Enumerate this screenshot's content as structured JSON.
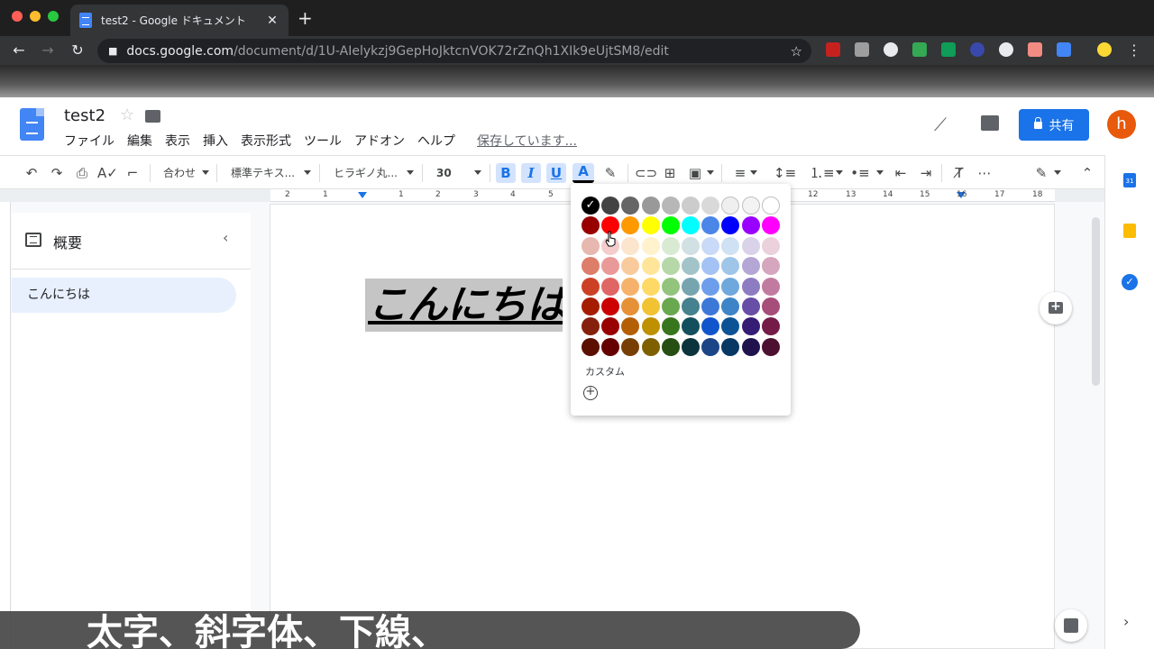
{
  "browser": {
    "tab_title": "test2 - Google ドキュメント",
    "tab_close": "✕",
    "new_tab": "+",
    "url_host": "docs.google.com",
    "url_path": "/document/d/1U-AIelykzj9GepHoJktcnVOK72rZnQh1XIk9eUjtSM8/edit"
  },
  "docs": {
    "title": "test2",
    "menu": [
      "ファイル",
      "編集",
      "表示",
      "挿入",
      "表示形式",
      "ツール",
      "アドオン",
      "ヘルプ"
    ],
    "save_status": "保存しています...",
    "share_label": "共有",
    "avatar_letter": "h"
  },
  "toolbar": {
    "zoom": "合わせ",
    "style": "標準テキス...",
    "font": "ヒラギノ丸...",
    "size": "30",
    "bold": "B",
    "italic": "I",
    "underline": "U",
    "text_color": "A"
  },
  "ruler": {
    "numbers": [
      "2",
      "1",
      "1",
      "2",
      "3",
      "4",
      "5",
      "12",
      "13",
      "14",
      "15",
      "16",
      "17",
      "18"
    ]
  },
  "outline": {
    "title": "概要",
    "items": [
      "こんにちは"
    ]
  },
  "document": {
    "selected_text": "こんにちは"
  },
  "palette": {
    "rows": [
      [
        "#000000",
        "#434343",
        "#666666",
        "#999999",
        "#b7b7b7",
        "#cccccc",
        "#d9d9d9",
        "#efefef",
        "#f3f3f3",
        "#ffffff"
      ],
      [
        "#980000",
        "#ff0000",
        "#ff9900",
        "#ffff00",
        "#00ff00",
        "#00ffff",
        "#4a86e8",
        "#0000ff",
        "#9900ff",
        "#ff00ff"
      ],
      [
        "#e6b8af",
        "#f4cccc",
        "#fce5cd",
        "#fff2cc",
        "#d9ead3",
        "#d0e0e3",
        "#c9daf8",
        "#cfe2f3",
        "#d9d2e9",
        "#ead1dc"
      ],
      [
        "#dd7e6b",
        "#ea9999",
        "#f9cb9c",
        "#ffe599",
        "#b6d7a8",
        "#a2c4c9",
        "#a4c2f4",
        "#9fc5e8",
        "#b4a7d6",
        "#d5a6bd"
      ],
      [
        "#cc4125",
        "#e06666",
        "#f6b26b",
        "#ffd966",
        "#93c47d",
        "#76a5af",
        "#6d9eeb",
        "#6fa8dc",
        "#8e7cc3",
        "#c27ba0"
      ],
      [
        "#a61c00",
        "#cc0000",
        "#e69138",
        "#f1c232",
        "#6aa84f",
        "#45818e",
        "#3c78d8",
        "#3d85c6",
        "#674ea7",
        "#a64d79"
      ],
      [
        "#85200c",
        "#990000",
        "#b45f06",
        "#bf9000",
        "#38761d",
        "#134f5c",
        "#1155cc",
        "#0b5394",
        "#351c75",
        "#741b47"
      ],
      [
        "#5b0f00",
        "#660000",
        "#783f04",
        "#7f6000",
        "#274e13",
        "#0c343d",
        "#1c4587",
        "#073763",
        "#20124d",
        "#4c1130"
      ]
    ],
    "custom_label": "カスタム",
    "custom_add": "+"
  },
  "caption": {
    "text": "太字、斜字体、下線、"
  }
}
